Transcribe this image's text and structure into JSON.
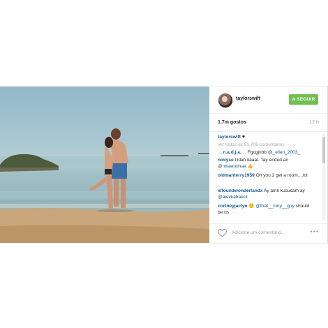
{
  "post": {
    "username": "taylorswift",
    "follow_label": "A SEGUIR",
    "likes": "1.7m gostos",
    "time": "12 h"
  },
  "caption": {
    "username": "taylorswift",
    "text": "♥"
  },
  "view_all": "ver todos os 51,708 comentários",
  "comments": [
    {
      "user": "__n.a.d.j.a.__",
      "pre": " Fgcgjnbb ",
      "mention": "@_ellen_2003_",
      "post": ""
    },
    {
      "user": "niniyse",
      "pre": " Udah liaaat. Tay endud an ",
      "mention": "@miaandinaa",
      "post": " 👍"
    },
    {
      "user": "oldmanterry1959",
      "pre": " Oh you 2 get a room....lol",
      "mention": "",
      "post": ""
    },
    {
      "user": "xifoundwonderlandx",
      "pre": " Ay amk kusucam ay ",
      "mention": "@alevkabakcii",
      "post": ""
    },
    {
      "user": "cortneyjaclyn",
      "pre": " 🙂 ",
      "mention": "@that__tony__guy",
      "post": " should be us"
    }
  ],
  "footer": {
    "placeholder": "Adicione um comentário...",
    "more": "•••"
  },
  "icons": [
    "heart-icon",
    "more-options-icon"
  ],
  "colors": {
    "follow_button": "#70c050",
    "link": "#125688"
  }
}
